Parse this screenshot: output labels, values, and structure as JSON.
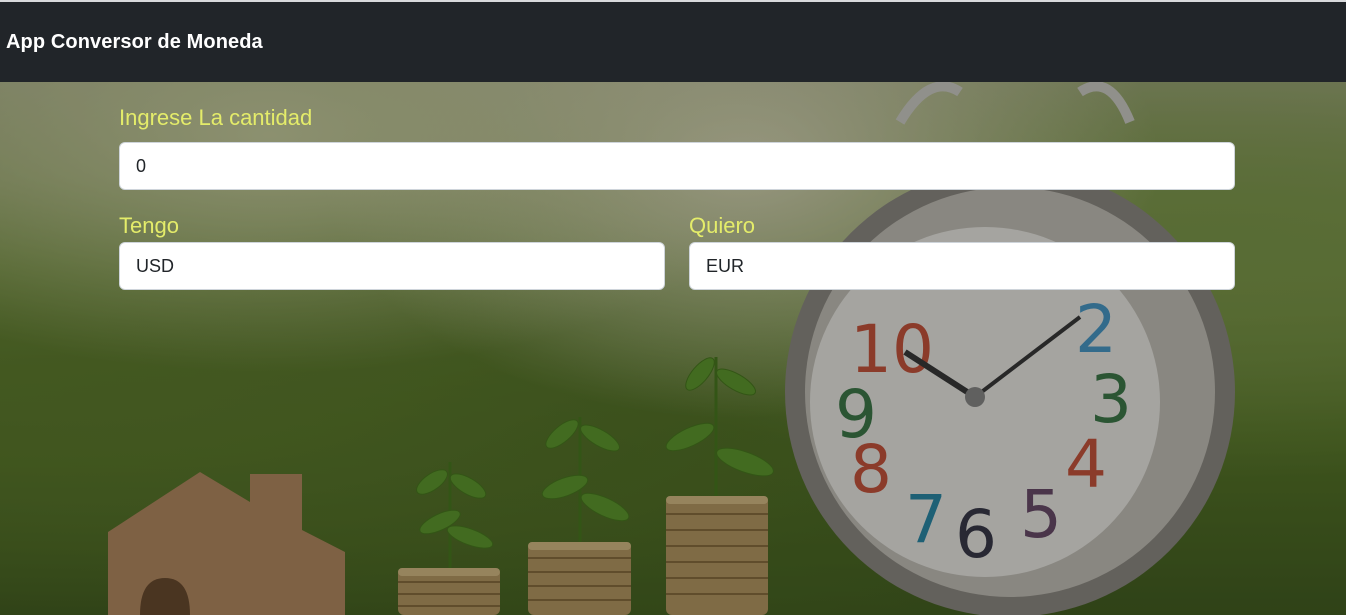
{
  "app": {
    "title": "App Conversor de Moneda"
  },
  "form": {
    "amount": {
      "label": "Ingrese La cantidad",
      "value": "0"
    },
    "from_currency": {
      "label": "Tengo",
      "value": "USD"
    },
    "to_currency": {
      "label": "Quiero",
      "value": "EUR"
    }
  },
  "colors": {
    "navbar": "#212529",
    "label": "#e4ec6a",
    "field_bg": "#ffffff"
  },
  "icons": {
    "background": "clock-coins-plants-photo"
  }
}
